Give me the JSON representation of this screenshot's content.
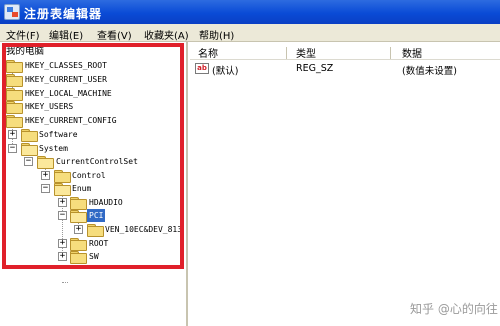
{
  "window": {
    "title": "注册表编辑器"
  },
  "menu": [
    {
      "label": "文件(F)"
    },
    {
      "label": "编辑(E)"
    },
    {
      "label": "查看(V)"
    },
    {
      "label": "收藏夹(A)"
    },
    {
      "label": "帮助(H)"
    }
  ],
  "tree": {
    "root": "我的电脑",
    "nodes": [
      {
        "label": "HKEY_CLASSES_ROOT"
      },
      {
        "label": "HKEY_CURRENT_USER"
      },
      {
        "label": "HKEY_LOCAL_MACHINE"
      },
      {
        "label": "HKEY_USERS"
      },
      {
        "label": "HKEY_CURRENT_CONFIG"
      },
      {
        "label": "Software",
        "expander": "+"
      },
      {
        "label": "System",
        "expander": "−"
      },
      {
        "label": "CurrentControlSet",
        "expander": "−"
      },
      {
        "label": "Control",
        "expander": "+"
      },
      {
        "label": "Enum",
        "expander": "−"
      },
      {
        "label": "HDAUDIO",
        "expander": "+"
      },
      {
        "label": "PCI",
        "expander": "−",
        "selected": true
      },
      {
        "label": "VEN_10EC&DEV_813",
        "expander": "+"
      },
      {
        "label": "ROOT",
        "expander": "+"
      },
      {
        "label": "SW",
        "expander": "+"
      }
    ]
  },
  "list": {
    "columns": [
      "名称",
      "类型",
      "数据"
    ],
    "rows": [
      {
        "icon": "ab",
        "name": "(默认)",
        "type": "REG_SZ",
        "data": "(数值未设置)"
      }
    ]
  },
  "watermark": "知乎 @心的向往",
  "colors": {
    "titlebar": "#0a4bd6",
    "highlight_border": "#e0202a",
    "selection": "#316ac5"
  }
}
